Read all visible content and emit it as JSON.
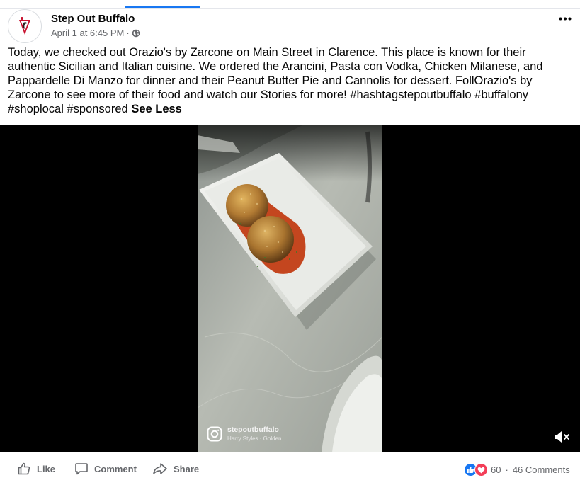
{
  "post": {
    "author": "Step Out Buffalo",
    "timestamp": "April 1 at 6:45 PM",
    "separator": "·",
    "privacy_icon": "globe-icon",
    "more_icon": "ellipsis-icon",
    "caption": "Today, we checked out Orazio's by Zarcone on Main Street in Clarence. This place is known for their authentic Sicilian and Italian cuisine. We ordered the Arancini, Pasta con Vodka, Chicken Milanese, and Pappardelle Di Manzo for dinner and their Peanut Butter Pie and Cannolis for dessert. FollOrazio's by Zarcone to see more of their food and watch our Stories for more! #hashtagstepoutbuffalo #buffalony #shoplocal #sponsored",
    "see_less": "See Less"
  },
  "video": {
    "watermark_handle": "stepoutbuffalo",
    "watermark_song": "Harry Styles · Golden",
    "watermark_icon": "instagram-icon",
    "mute_icon": "muted-speaker-icon"
  },
  "actions": {
    "like": "Like",
    "comment": "Comment",
    "share": "Share"
  },
  "stats": {
    "reaction_count": "60",
    "separator": "·",
    "comments": "46 Comments"
  },
  "colors": {
    "accent": "#1877f2",
    "love": "#f33e58",
    "secondary_text": "#65676b",
    "brand_red": "#c8102e"
  }
}
